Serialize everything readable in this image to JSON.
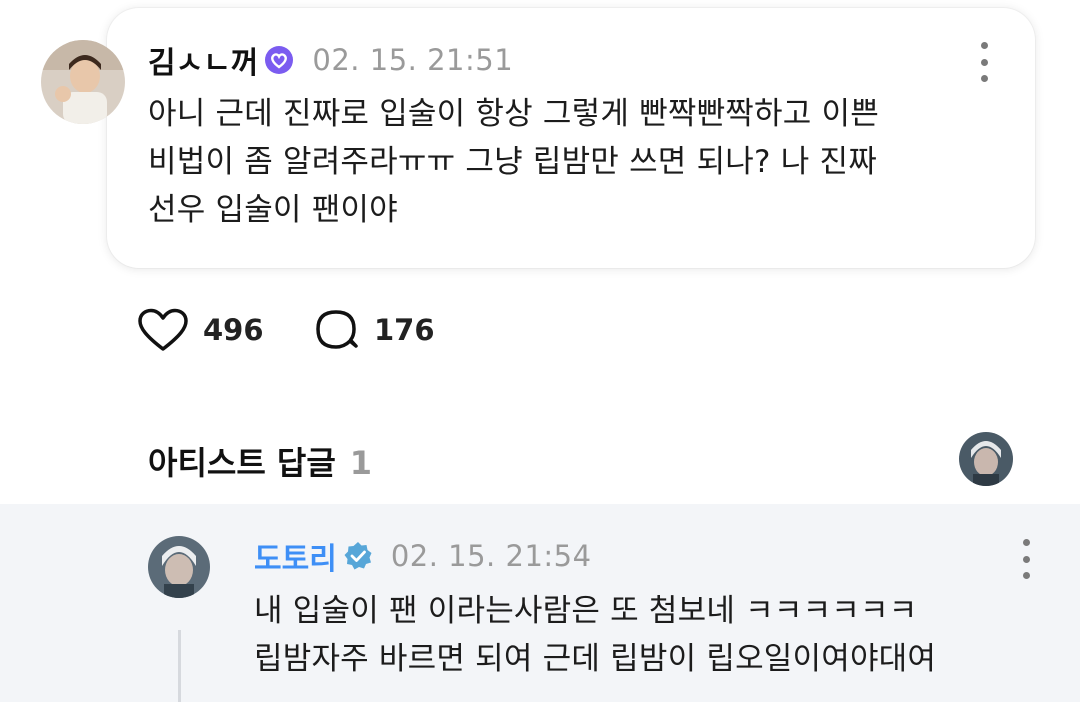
{
  "post": {
    "author": "김ㅅㄴ꺼",
    "timestamp": "02. 15. 21:51",
    "body": "아니 근데 진짜로 입술이 항상 그렇게 빤짝빤짝하고 이쁜\n비법이 좀 알려주라ㅠㅠ 그냥 립밤만 쓰면 되나? 나 진짜\n선우 입술이 팬이야",
    "likes": "496",
    "comments": "176"
  },
  "artist_replies": {
    "title": "아티스트 답글",
    "count": "1"
  },
  "reply": {
    "author": "도토리",
    "timestamp": "02. 15. 21:54",
    "body": "내 입술이 팬 이라는사람은 또 첨보네 ㅋㅋㅋㅋㅋㅋ\n립밤자주 바르면 되여 근데 립밤이 립오일이여야대여"
  },
  "colors": {
    "artist_name": "#3e8ff6",
    "artist_badge": "#57a6d8",
    "fan_badge": "#7b5cf0",
    "reply_background": "#f3f5f8"
  },
  "icons": [
    "heart-icon",
    "comment-icon",
    "verified-badge-icon",
    "kebab-menu-icon"
  ]
}
